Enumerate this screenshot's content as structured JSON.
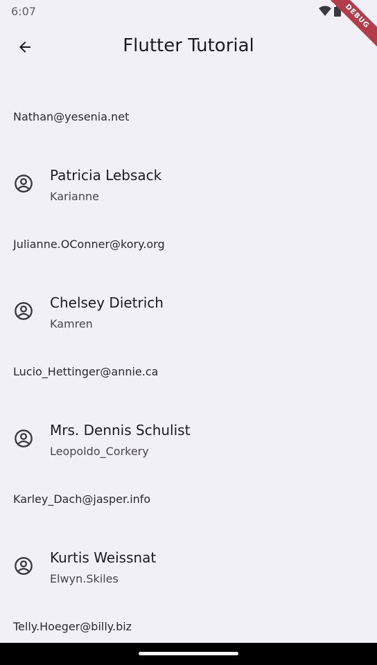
{
  "status_bar": {
    "time": "6:07",
    "icons": [
      "wifi-icon",
      "battery-icon"
    ]
  },
  "debug_banner": "DEBUG",
  "app_bar": {
    "title": "Flutter Tutorial",
    "back_icon": "arrow-back-icon"
  },
  "list": {
    "emails": [
      "Nathan@yesenia.net",
      "Julianne.OConner@kory.org",
      "Lucio_Hettinger@annie.ca",
      "Karley_Dach@jasper.info",
      "Telly.Hoeger@billy.biz"
    ],
    "users": [
      {
        "name": "Patricia Lebsack",
        "username": "Karianne"
      },
      {
        "name": "Chelsey Dietrich",
        "username": "Kamren"
      },
      {
        "name": "Mrs. Dennis Schulist",
        "username": "Leopoldo_Corkery"
      },
      {
        "name": "Kurtis Weissnat",
        "username": "Elwyn.Skiles"
      }
    ],
    "user_icon": "account-circle-icon"
  },
  "colors": {
    "background": "#f1f0f6",
    "debug_banner": "#b13c4a",
    "text": "#1c1b1f"
  }
}
